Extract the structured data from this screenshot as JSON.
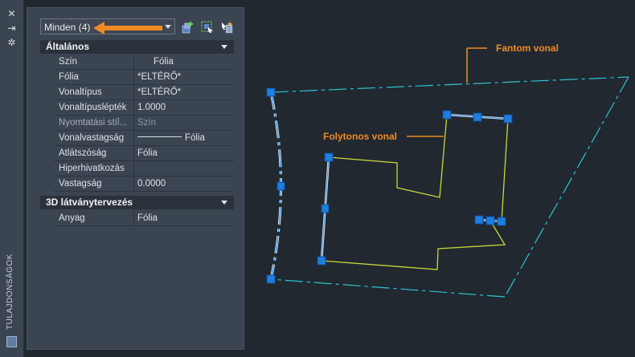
{
  "left_strip": {
    "title": "TULAJDONSÁGOK",
    "controls": [
      "close-icon",
      "auto-hide-icon",
      "settings-icon"
    ]
  },
  "toolbar": {
    "selection_label": "Minden (4)",
    "buttons": [
      "toggle-pickadd-icon",
      "select-objects-icon",
      "quick-select-icon"
    ]
  },
  "sections": [
    {
      "title": "Általános",
      "rows": [
        {
          "label": "Szín",
          "value": "Fólia"
        },
        {
          "label": "Fólia",
          "value": "*ELTÉRŐ*"
        },
        {
          "label": "Vonaltípus",
          "value": "*ELTÉRŐ*"
        },
        {
          "label": "Vonaltípuslépték",
          "value": "1.0000"
        },
        {
          "label": "Nyomtatási stíl...",
          "value": "Szín"
        },
        {
          "label": "Vonalvastagság",
          "value": "Fólia"
        },
        {
          "label": "Átlátszóság",
          "value": "Fólia"
        },
        {
          "label": "Hiperhivatkozás",
          "value": ""
        },
        {
          "label": "Vastagság",
          "value": "0.0000"
        }
      ]
    },
    {
      "title": "3D látványtervezés",
      "rows": [
        {
          "label": "Anyag",
          "value": "Fólia"
        }
      ]
    }
  ],
  "annotations": {
    "phantom": "Fantom vonal",
    "continuous": "Folytonos vonal"
  },
  "colors": {
    "canvas_bg": "#212830",
    "panel_bg": "#3b4451",
    "phantom_line": "#2ec4d4",
    "continuous_line": "#c7d93a",
    "grip": "#1e7fe0",
    "annotation": "#f08a24"
  }
}
